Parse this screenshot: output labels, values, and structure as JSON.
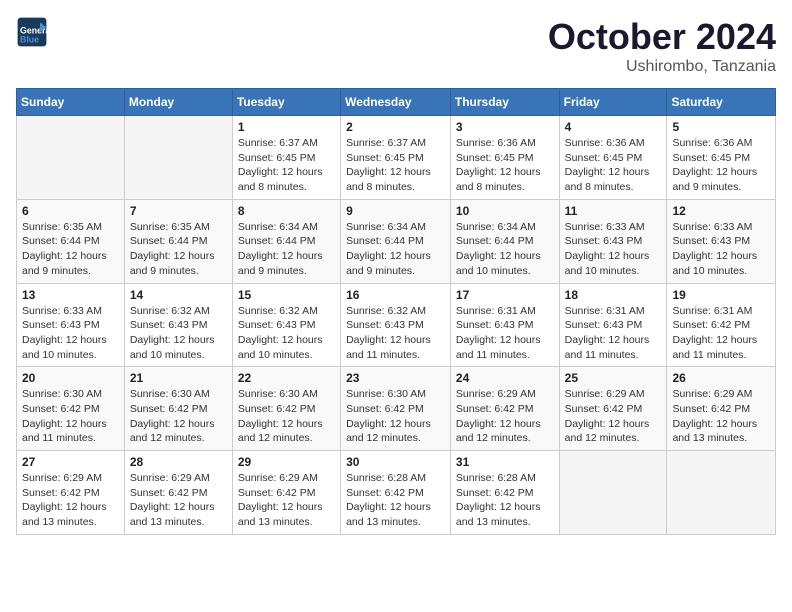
{
  "logo": {
    "line1": "General",
    "line2": "Blue"
  },
  "title": "October 2024",
  "subtitle": "Ushirombo, Tanzania",
  "weekdays": [
    "Sunday",
    "Monday",
    "Tuesday",
    "Wednesday",
    "Thursday",
    "Friday",
    "Saturday"
  ],
  "weeks": [
    [
      {
        "day": "",
        "info": ""
      },
      {
        "day": "",
        "info": ""
      },
      {
        "day": "1",
        "info": "Sunrise: 6:37 AM\nSunset: 6:45 PM\nDaylight: 12 hours and 8 minutes."
      },
      {
        "day": "2",
        "info": "Sunrise: 6:37 AM\nSunset: 6:45 PM\nDaylight: 12 hours and 8 minutes."
      },
      {
        "day": "3",
        "info": "Sunrise: 6:36 AM\nSunset: 6:45 PM\nDaylight: 12 hours and 8 minutes."
      },
      {
        "day": "4",
        "info": "Sunrise: 6:36 AM\nSunset: 6:45 PM\nDaylight: 12 hours and 8 minutes."
      },
      {
        "day": "5",
        "info": "Sunrise: 6:36 AM\nSunset: 6:45 PM\nDaylight: 12 hours and 9 minutes."
      }
    ],
    [
      {
        "day": "6",
        "info": "Sunrise: 6:35 AM\nSunset: 6:44 PM\nDaylight: 12 hours and 9 minutes."
      },
      {
        "day": "7",
        "info": "Sunrise: 6:35 AM\nSunset: 6:44 PM\nDaylight: 12 hours and 9 minutes."
      },
      {
        "day": "8",
        "info": "Sunrise: 6:34 AM\nSunset: 6:44 PM\nDaylight: 12 hours and 9 minutes."
      },
      {
        "day": "9",
        "info": "Sunrise: 6:34 AM\nSunset: 6:44 PM\nDaylight: 12 hours and 9 minutes."
      },
      {
        "day": "10",
        "info": "Sunrise: 6:34 AM\nSunset: 6:44 PM\nDaylight: 12 hours and 10 minutes."
      },
      {
        "day": "11",
        "info": "Sunrise: 6:33 AM\nSunset: 6:43 PM\nDaylight: 12 hours and 10 minutes."
      },
      {
        "day": "12",
        "info": "Sunrise: 6:33 AM\nSunset: 6:43 PM\nDaylight: 12 hours and 10 minutes."
      }
    ],
    [
      {
        "day": "13",
        "info": "Sunrise: 6:33 AM\nSunset: 6:43 PM\nDaylight: 12 hours and 10 minutes."
      },
      {
        "day": "14",
        "info": "Sunrise: 6:32 AM\nSunset: 6:43 PM\nDaylight: 12 hours and 10 minutes."
      },
      {
        "day": "15",
        "info": "Sunrise: 6:32 AM\nSunset: 6:43 PM\nDaylight: 12 hours and 10 minutes."
      },
      {
        "day": "16",
        "info": "Sunrise: 6:32 AM\nSunset: 6:43 PM\nDaylight: 12 hours and 11 minutes."
      },
      {
        "day": "17",
        "info": "Sunrise: 6:31 AM\nSunset: 6:43 PM\nDaylight: 12 hours and 11 minutes."
      },
      {
        "day": "18",
        "info": "Sunrise: 6:31 AM\nSunset: 6:43 PM\nDaylight: 12 hours and 11 minutes."
      },
      {
        "day": "19",
        "info": "Sunrise: 6:31 AM\nSunset: 6:42 PM\nDaylight: 12 hours and 11 minutes."
      }
    ],
    [
      {
        "day": "20",
        "info": "Sunrise: 6:30 AM\nSunset: 6:42 PM\nDaylight: 12 hours and 11 minutes."
      },
      {
        "day": "21",
        "info": "Sunrise: 6:30 AM\nSunset: 6:42 PM\nDaylight: 12 hours and 12 minutes."
      },
      {
        "day": "22",
        "info": "Sunrise: 6:30 AM\nSunset: 6:42 PM\nDaylight: 12 hours and 12 minutes."
      },
      {
        "day": "23",
        "info": "Sunrise: 6:30 AM\nSunset: 6:42 PM\nDaylight: 12 hours and 12 minutes."
      },
      {
        "day": "24",
        "info": "Sunrise: 6:29 AM\nSunset: 6:42 PM\nDaylight: 12 hours and 12 minutes."
      },
      {
        "day": "25",
        "info": "Sunrise: 6:29 AM\nSunset: 6:42 PM\nDaylight: 12 hours and 12 minutes."
      },
      {
        "day": "26",
        "info": "Sunrise: 6:29 AM\nSunset: 6:42 PM\nDaylight: 12 hours and 13 minutes."
      }
    ],
    [
      {
        "day": "27",
        "info": "Sunrise: 6:29 AM\nSunset: 6:42 PM\nDaylight: 12 hours and 13 minutes."
      },
      {
        "day": "28",
        "info": "Sunrise: 6:29 AM\nSunset: 6:42 PM\nDaylight: 12 hours and 13 minutes."
      },
      {
        "day": "29",
        "info": "Sunrise: 6:29 AM\nSunset: 6:42 PM\nDaylight: 12 hours and 13 minutes."
      },
      {
        "day": "30",
        "info": "Sunrise: 6:28 AM\nSunset: 6:42 PM\nDaylight: 12 hours and 13 minutes."
      },
      {
        "day": "31",
        "info": "Sunrise: 6:28 AM\nSunset: 6:42 PM\nDaylight: 12 hours and 13 minutes."
      },
      {
        "day": "",
        "info": ""
      },
      {
        "day": "",
        "info": ""
      }
    ]
  ]
}
